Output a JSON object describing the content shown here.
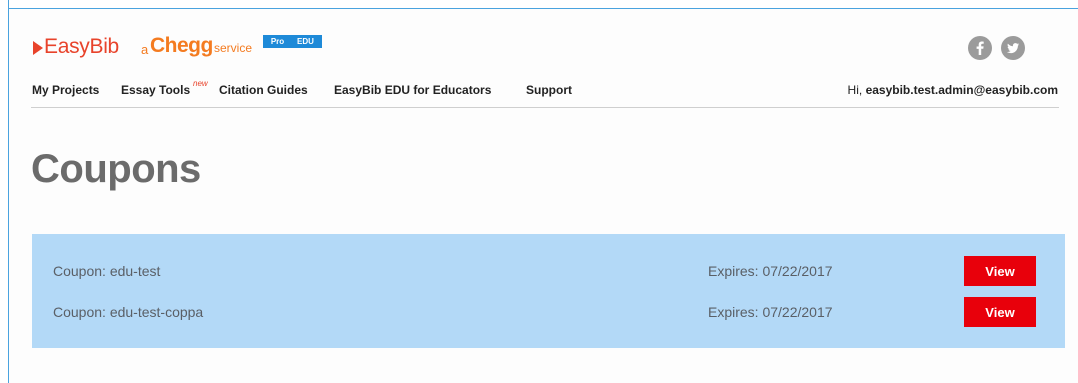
{
  "brand": {
    "easybib": "EasyBib",
    "a": "a",
    "chegg": "Chegg",
    "service": "service",
    "badges": [
      "Pro",
      "EDU"
    ],
    "colors": {
      "easybib": "#e8432b",
      "chegg": "#f47b20",
      "badge": "#1e8ad8"
    }
  },
  "social": [
    "facebook-icon",
    "twitter-icon"
  ],
  "nav": {
    "items": [
      {
        "label": "My Projects"
      },
      {
        "label": "Essay Tools",
        "tag": "new"
      },
      {
        "label": "Citation Guides"
      },
      {
        "label": "EasyBib EDU for Educators"
      },
      {
        "label": "Support"
      }
    ],
    "greeting_prefix": "Hi,",
    "user": "easybib.test.admin@easybib.com"
  },
  "page": {
    "title": "Coupons"
  },
  "coupons": {
    "rows": [
      {
        "name": "Coupon: edu-test",
        "expires": "Expires: 07/22/2017",
        "action": "View"
      },
      {
        "name": "Coupon: edu-test-coppa",
        "expires": "Expires: 07/22/2017",
        "action": "View"
      }
    ],
    "colors": {
      "panel": "#b3d9f7",
      "button": "#e8000b"
    }
  }
}
